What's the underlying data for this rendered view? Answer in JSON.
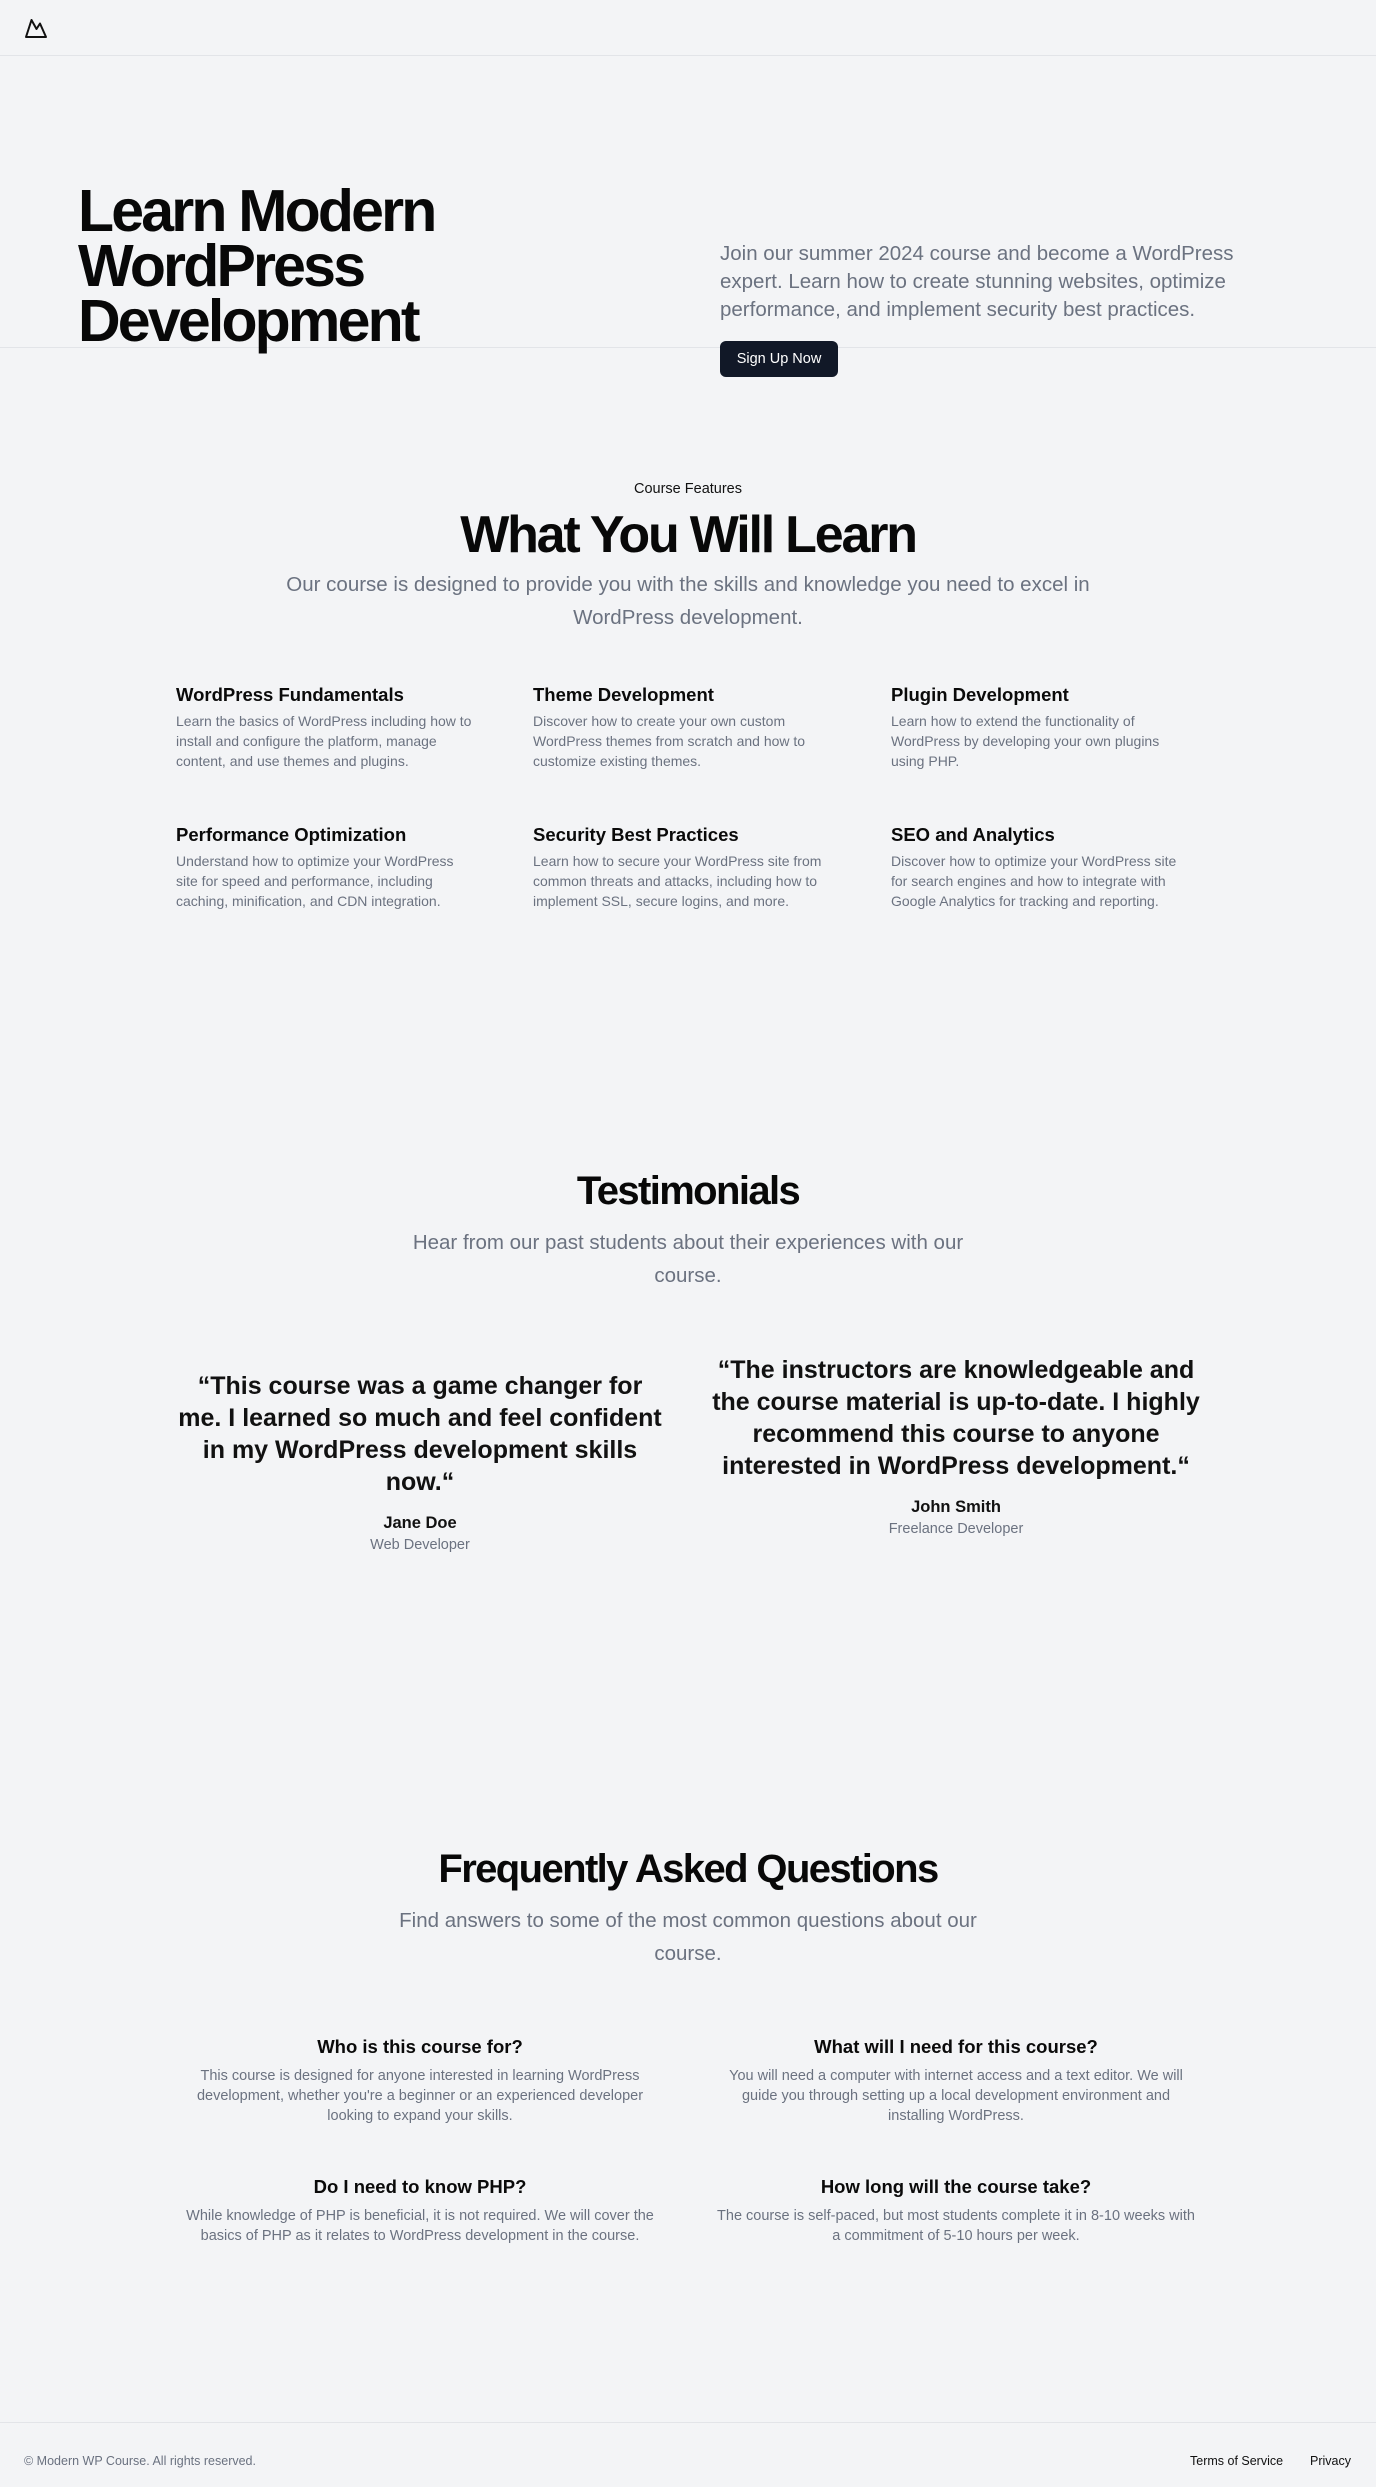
{
  "header": {
    "logo_icon": "mountain-icon"
  },
  "hero": {
    "title": "Learn Modern WordPress Development",
    "description": "Join our summer 2024 course and become a WordPress expert. Learn how to create stunning websites, optimize performance, and implement security best practices.",
    "cta_label": "Sign Up Now"
  },
  "features": {
    "eyebrow": "Course Features",
    "heading": "What You Will Learn",
    "subheading": "Our course is designed to provide you with the skills and knowledge you need to excel in WordPress development.",
    "items": [
      {
        "title": "WordPress Fundamentals",
        "description": "Learn the basics of WordPress including how to install and configure the platform, manage content, and use themes and plugins."
      },
      {
        "title": "Theme Development",
        "description": "Discover how to create your own custom WordPress themes from scratch and how to customize existing themes."
      },
      {
        "title": "Plugin Development",
        "description": "Learn how to extend the functionality of WordPress by developing your own plugins using PHP."
      },
      {
        "title": "Performance Optimization",
        "description": "Understand how to optimize your WordPress site for speed and performance, including caching, minification, and CDN integration."
      },
      {
        "title": "Security Best Practices",
        "description": "Learn how to secure your WordPress site from common threats and attacks, including how to implement SSL, secure logins, and more."
      },
      {
        "title": "SEO and Analytics",
        "description": "Discover how to optimize your WordPress site for search engines and how to integrate with Google Analytics for tracking and reporting."
      }
    ]
  },
  "testimonials": {
    "heading": "Testimonials",
    "subheading": "Hear from our past students about their experiences with our course.",
    "items": [
      {
        "quote": "“This course was a game changer for me. I learned so much and feel confident in my WordPress development skills now.“",
        "name": "Jane Doe",
        "role": "Web Developer"
      },
      {
        "quote": "“The instructors are knowledgeable and the course material is up-to-date. I highly recommend this course to anyone interested in WordPress development.“",
        "name": "John Smith",
        "role": "Freelance Developer"
      }
    ]
  },
  "faq": {
    "heading": "Frequently Asked Questions",
    "subheading": "Find answers to some of the most common questions about our course.",
    "items": [
      {
        "question": "Who is this course for?",
        "answer": "This course is designed for anyone interested in learning WordPress development, whether you're a beginner or an experienced developer looking to expand your skills."
      },
      {
        "question": "What will I need for this course?",
        "answer": "You will need a computer with internet access and a text editor. We will guide you through setting up a local development environment and installing WordPress."
      },
      {
        "question": "Do I need to know PHP?",
        "answer": "While knowledge of PHP is beneficial, it is not required. We will cover the basics of PHP as it relates to WordPress development in the course."
      },
      {
        "question": "How long will the course take?",
        "answer": "The course is self-paced, but most students complete it in 8-10 weeks with a commitment of 5-10 hours per week."
      }
    ]
  },
  "footer": {
    "copyright": "© Modern WP Course. All rights reserved.",
    "links": [
      "Terms of Service",
      "Privacy"
    ]
  }
}
